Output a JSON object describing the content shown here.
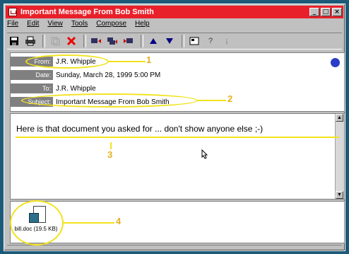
{
  "window": {
    "title": "Important Message From Bob Smith"
  },
  "menu": [
    "File",
    "Edit",
    "View",
    "Tools",
    "Compose",
    "Help"
  ],
  "header": {
    "from_label": "From:",
    "from": "J.R. Whipple",
    "date_label": "Date:",
    "date": "Sunday, March 28, 1999 5:00 PM",
    "to_label": "To:",
    "to": "J.R. Whipple",
    "subject_label": "Subject:",
    "subject": "Important Message From Bob Smith"
  },
  "message": {
    "body": "Here is that document you asked for ... don't show anyone else ;-)"
  },
  "attachment": {
    "filename": "bill.doc (19.5 KB)"
  },
  "annotations": [
    "1",
    "2",
    "3",
    "4"
  ],
  "colors": {
    "titlebar": "#e8202a",
    "highlight": "#f2e21d",
    "label_bg": "#808080",
    "desktop": "#1c5a78"
  }
}
